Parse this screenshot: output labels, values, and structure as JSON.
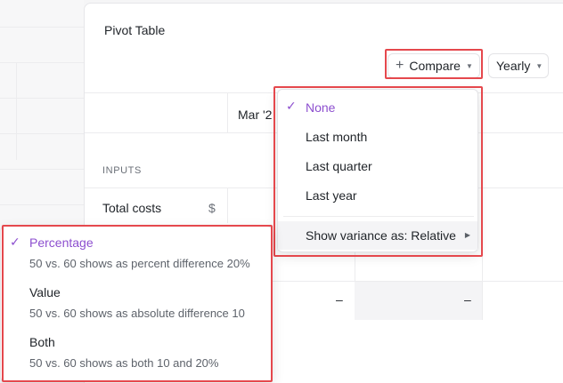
{
  "panel": {
    "title": "Pivot Table"
  },
  "toolbar": {
    "compare_label": "Compare",
    "yearly_label": "Yearly"
  },
  "table": {
    "column_header": "Mar '2",
    "section": "INPUTS",
    "row_label": "Total costs",
    "row_unit": "$",
    "empty_cells": [
      "–",
      "–"
    ]
  },
  "compare_menu": {
    "items": [
      {
        "label": "None",
        "selected": true
      },
      {
        "label": "Last month",
        "selected": false
      },
      {
        "label": "Last quarter",
        "selected": false
      },
      {
        "label": "Last year",
        "selected": false
      }
    ],
    "variance_label": "Show variance as: Relative"
  },
  "variance_menu": {
    "items": [
      {
        "label": "Percentage",
        "description": "50 vs. 60 shows as percent difference 20%",
        "selected": true
      },
      {
        "label": "Value",
        "description": "50 vs. 60 shows as absolute difference 10",
        "selected": false
      },
      {
        "label": "Both",
        "description": "50 vs. 60 shows as both 10 and 20%",
        "selected": false
      }
    ]
  },
  "colors": {
    "accent": "#8d4fcf",
    "highlight": "#e5484d"
  }
}
